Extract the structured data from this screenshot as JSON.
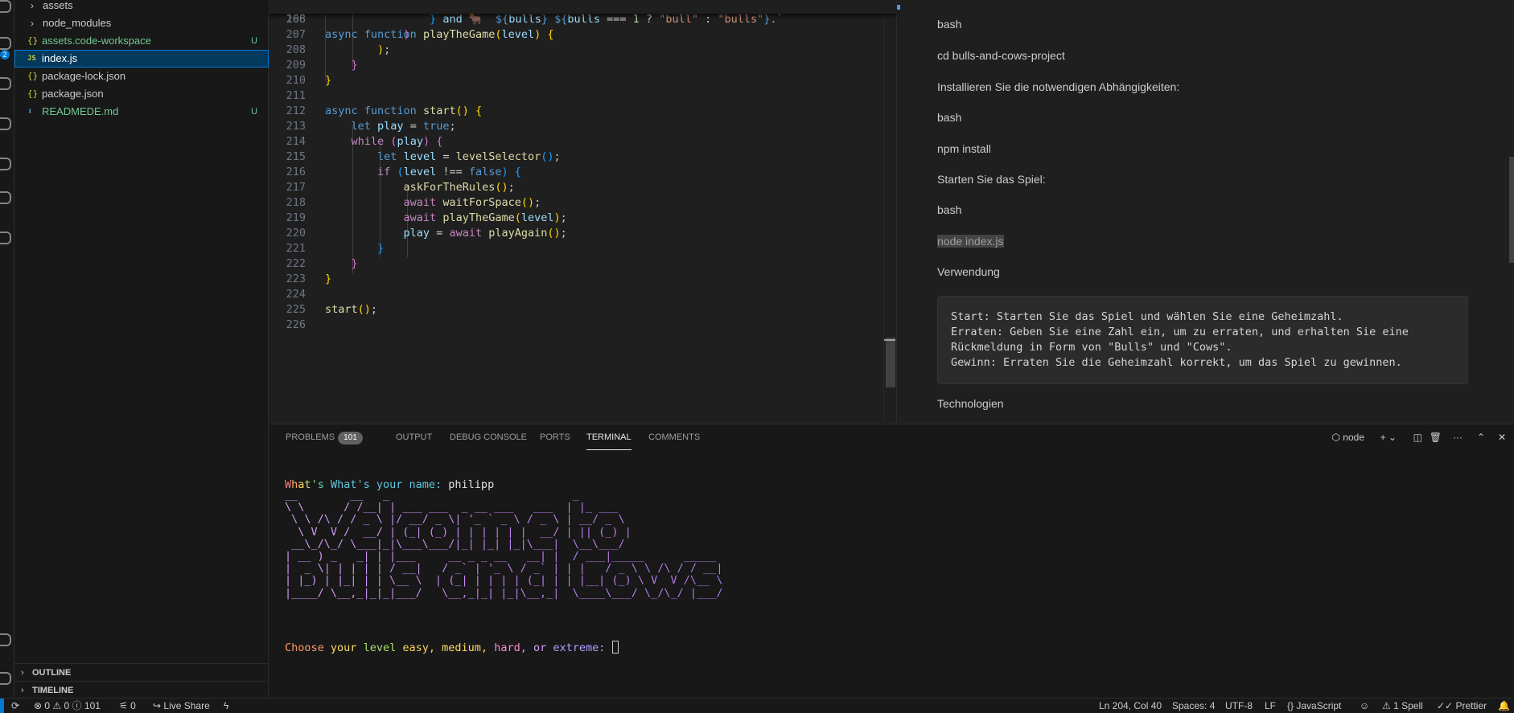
{
  "activity_bar": {
    "source_control_badge": "2"
  },
  "explorer": {
    "items": [
      {
        "label": "assets",
        "type": "folder"
      },
      {
        "label": "node_modules",
        "type": "folder"
      },
      {
        "label": "assets.code-workspace",
        "type": "json",
        "git": "U"
      },
      {
        "label": "index.js",
        "type": "js",
        "git": ""
      },
      {
        "label": "package-lock.json",
        "type": "json",
        "git": ""
      },
      {
        "label": "package.json",
        "type": "json",
        "git": ""
      },
      {
        "label": "READMEDE.md",
        "type": "md",
        "git": "U"
      }
    ],
    "outline_label": "OUTLINE",
    "timeline_label": "TIMELINE"
  },
  "editor": {
    "sticky_line_number": "168",
    "line_numbers": [
      "206",
      "207",
      "208",
      "209",
      "210",
      "211",
      "212",
      "213",
      "214",
      "215",
      "216",
      "217",
      "218",
      "219",
      "220",
      "221",
      "222",
      "223",
      "224",
      "225",
      "226"
    ]
  },
  "preview": {
    "lines": [
      "bash",
      "cd bulls-and-cows-project",
      "Installieren Sie die notwendigen Abhängigkeiten:",
      "bash",
      "npm install",
      "Starten Sie das Spiel:",
      "bash",
      "node index.js",
      "Verwendung"
    ],
    "code_block": [
      "Start: Starten Sie das Spiel und wählen Sie eine Geheimzahl.",
      "Erraten: Geben Sie eine Zahl ein, um zu erraten, und erhalten Sie eine",
      "Rückmeldung in Form von \"Bulls\" und \"Cows\".",
      "Gewinn: Erraten Sie die Geheimzahl korrekt, um das Spiel zu gewinnen."
    ],
    "after": "Technologien"
  },
  "panel": {
    "tabs": [
      {
        "label": "PROBLEMS",
        "count": "101"
      },
      {
        "label": "OUTPUT"
      },
      {
        "label": "DEBUG CONSOLE"
      },
      {
        "label": "PORTS"
      },
      {
        "label": "TERMINAL"
      },
      {
        "label": "COMMENTS"
      }
    ],
    "terminal_name": "node",
    "prompt_name_label": "What's your name:",
    "prompt_name_value": "philipp",
    "ascii_art": [
      "__        __   _                            _",
      "\\ \\      / /__| | ___ ___  _ __ ___   ___  | |_ ___",
      " \\ \\ /\\ / / _ \\ |/ __/ _ \\| '_ ` _ \\ / _ \\ | __/ _ \\",
      "  \\ V  V /  __/ | (_| (_) | | | | | |  __/ | || (_) |",
      " __\\_/\\_/ \\___|_|\\___\\___/|_| |_| |_|\\___|  \\__\\___/",
      "| __ ) _   _| | |___     __ _ _ __   __| |  / ___|_____      _____",
      "|  _ \\| | | | | / __|   / _` | '_ \\ / _` | | |   / _ \\ \\ /\\ / / __|",
      "| |_) | |_| | | \\__ \\  | (_| | | | | (_| | | |__| (_) \\ V  V /\\__ \\",
      "|____/ \\__,_|_|_|___/   \\__,_|_| |_|\\__,_|  \\____\\___/ \\_/\\_/ |___/"
    ],
    "level_prompt": [
      "Choose",
      "your",
      "level",
      "easy,",
      "medium,",
      "hard,",
      "or",
      "extreme:"
    ]
  },
  "statusbar": {
    "errors": "0",
    "warnings": "0",
    "infos": "101",
    "ports": "0",
    "live_share": "Live Share",
    "cursor": "Ln 204, Col 40",
    "spaces": "Spaces: 4",
    "encoding": "UTF-8",
    "eol": "LF",
    "language": "JavaScript",
    "spell": "1 Spell",
    "prettier": "Prettier"
  },
  "colors": {
    "accent": "#0078d4",
    "git_untracked": "#73c991",
    "ascii": "#c483f0"
  }
}
